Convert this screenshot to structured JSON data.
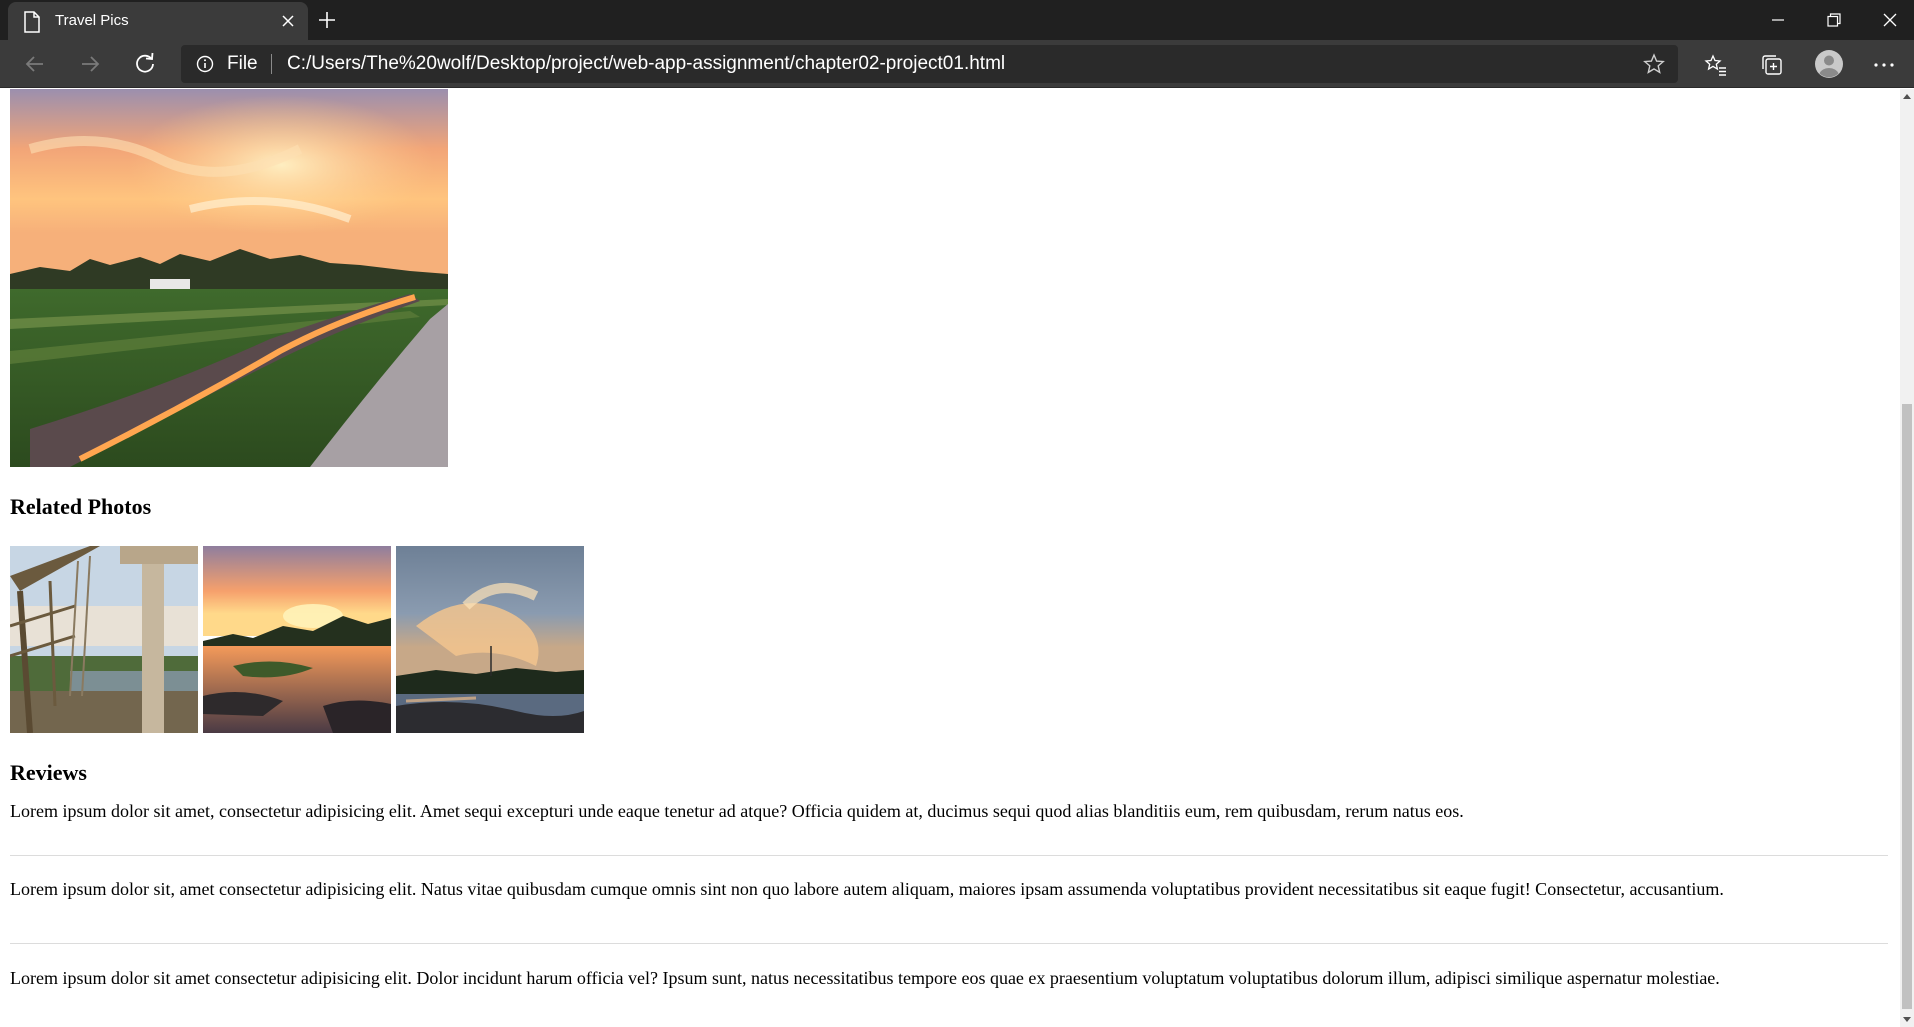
{
  "browser": {
    "tab_title": "Travel Pics",
    "file_label": "File",
    "url": "C:/Users/The%20wolf/Desktop/project/web-app-assignment/chapter02-project01.html",
    "icons": {
      "tab_page": "page-icon",
      "tab_close": "close-icon",
      "new_tab": "plus-icon",
      "minimize": "minimize-icon",
      "maximize": "restore-icon",
      "window_close": "close-icon",
      "back": "arrow-left-icon",
      "forward": "arrow-right-icon",
      "refresh": "refresh-icon",
      "info": "info-icon",
      "favorite": "star-icon",
      "favorites": "favorites-icon",
      "collections": "collections-icon",
      "profile": "profile-icon",
      "more": "more-icon"
    },
    "colors": {
      "titlebar": "#202020",
      "toolbar": "#3b3b3b",
      "addressbar": "#2a2a2a"
    }
  },
  "page": {
    "related_heading": "Related Photos",
    "reviews_heading": "Reviews",
    "reviews": [
      "Lorem ipsum dolor sit amet, consectetur adipisicing elit. Amet sequi excepturi unde eaque tenetur ad atque? Officia quidem at, ducimus sequi quod alias blanditiis eum, rem quibusdam, rerum natus eos.",
      "Lorem ipsum dolor sit, amet consectetur adipisicing elit. Natus vitae quibusdam cumque omnis sint non quo labore autem aliquam, maiores ipsam assumenda voluptatibus provident necessitatibus sit eaque fugit! Consectetur, accusantium.",
      "Lorem ipsum dolor sit amet consectetur adipisicing elit. Dolor incidunt harum officia vel? Ipsum sunt, natus necessitatibus tempore eos quae ex praesentium voluptatum voluptatibus dolorum illum, adipisci similique aspernatur molestiae."
    ]
  }
}
